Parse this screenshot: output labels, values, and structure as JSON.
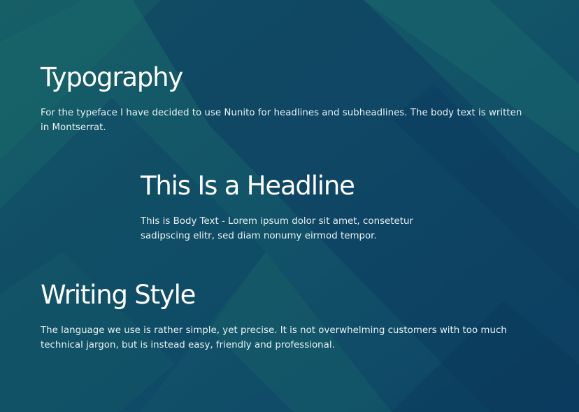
{
  "colors": {
    "background_dark": "#0b3a5e",
    "background_teal": "#166068",
    "text": "#ffffff"
  },
  "sections": [
    {
      "heading": "Typography",
      "body": "For the typeface I have decided to use Nunito for headlines and subheadlines. The body text is written in Montserrat."
    },
    {
      "heading": "This Is a Headline",
      "body": "This is Body Text - Lorem ipsum dolor sit amet, consetetur sadipscing elitr, sed diam nonumy eirmod tempor."
    },
    {
      "heading": "Writing Style",
      "body": "The language we use is rather simple, yet precise. It is not overwhelming customers with too much technical jargon, but is instead easy, friendly and professional."
    }
  ]
}
